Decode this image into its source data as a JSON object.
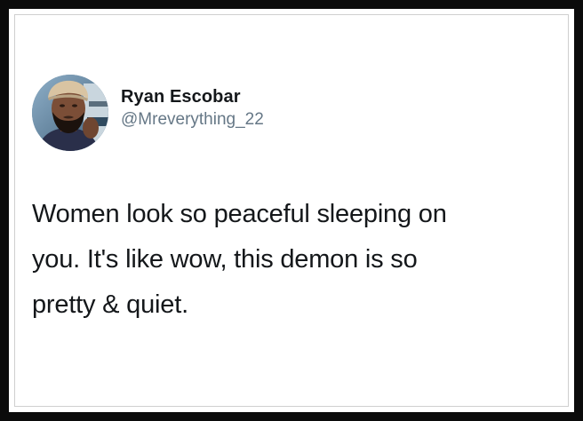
{
  "tweet": {
    "author": {
      "display_name": "Ryan Escobar",
      "handle": "@Mreverything_22",
      "avatar_icon": "profile-photo-avatar"
    },
    "text_lines": [
      "Women look so peaceful sleeping on",
      "you. It's like wow, this demon is so",
      "pretty & quiet."
    ]
  },
  "colors": {
    "background": "#ffffff",
    "frame": "#0b0b0b",
    "name": "#14171a",
    "handle": "#657786"
  }
}
